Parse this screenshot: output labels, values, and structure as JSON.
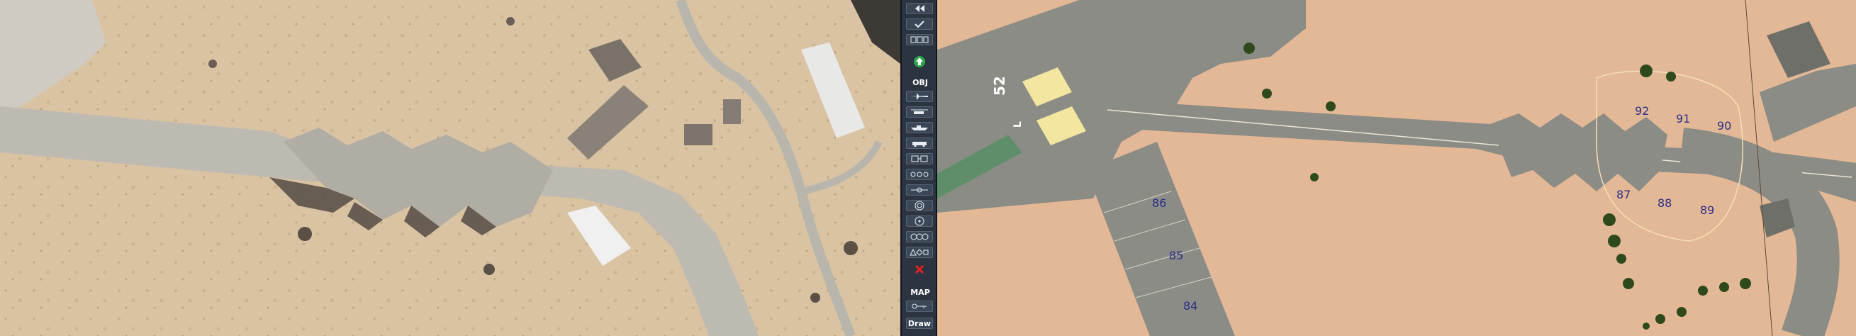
{
  "toolbar": {
    "obj_label": "OBJ",
    "map_label": "MAP",
    "draw_label": "Draw",
    "buttons": [
      {
        "name": "rewind-icon"
      },
      {
        "name": "checkmark-icon"
      },
      {
        "name": "grid-icon"
      },
      {
        "name": "up-arrow-icon",
        "color": "#2aa84a"
      },
      {
        "name": "aircraft-icon"
      },
      {
        "name": "helicopter-icon"
      },
      {
        "name": "ship-icon"
      },
      {
        "name": "vehicle-icon"
      },
      {
        "name": "building-icon"
      },
      {
        "name": "convoy-icon"
      },
      {
        "name": "waypoint-icon"
      },
      {
        "name": "target-ring-icon"
      },
      {
        "name": "circle-dot-icon"
      },
      {
        "name": "triple-circle-icon"
      },
      {
        "name": "shapes-icon"
      },
      {
        "name": "delete-icon",
        "color": "#e02020"
      },
      {
        "name": "key-icon"
      }
    ]
  },
  "map": {
    "runway_label": "52",
    "runway_sub_label": "L",
    "parking_spots": [
      "92",
      "91",
      "90",
      "87",
      "88",
      "89",
      "86",
      "85",
      "84"
    ],
    "colors": {
      "sand": "#e3b896",
      "asphalt": "#8c8c86",
      "tarmac_dark": "#6f6f6a",
      "runway_marks": "#f2e6a0",
      "threshold_green": "#5f8f6a",
      "tree": "#2e4a1d",
      "spot_text": "#2a2f86"
    }
  }
}
